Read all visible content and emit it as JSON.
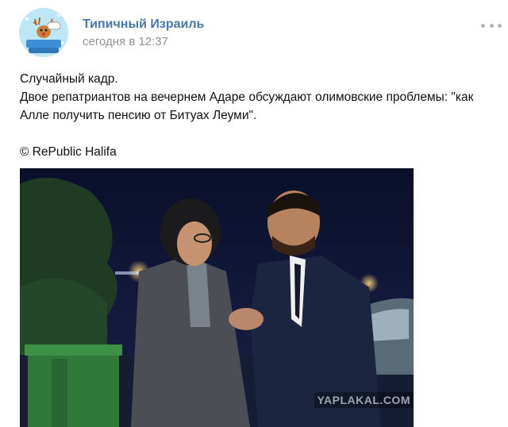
{
  "post": {
    "author": "Типичный Израиль",
    "date": "сегодня в 12:37",
    "text_lines": [
      "Случайный кадр.",
      "Двое репатриантов на вечернем Адаре обсуждают олимовские проблемы: \"как Алле получить пенсию от Битуах Леуми\".",
      "© RePublic Halifa"
    ],
    "photo_watermark": "YAPLAKAL.COM",
    "more_icon": "more-horizontal-icon",
    "avatar_icon": "community-logo-reindeer"
  },
  "colors": {
    "author": "#4a76a8",
    "date": "#939393",
    "more_dots": "#b0b5bb"
  }
}
